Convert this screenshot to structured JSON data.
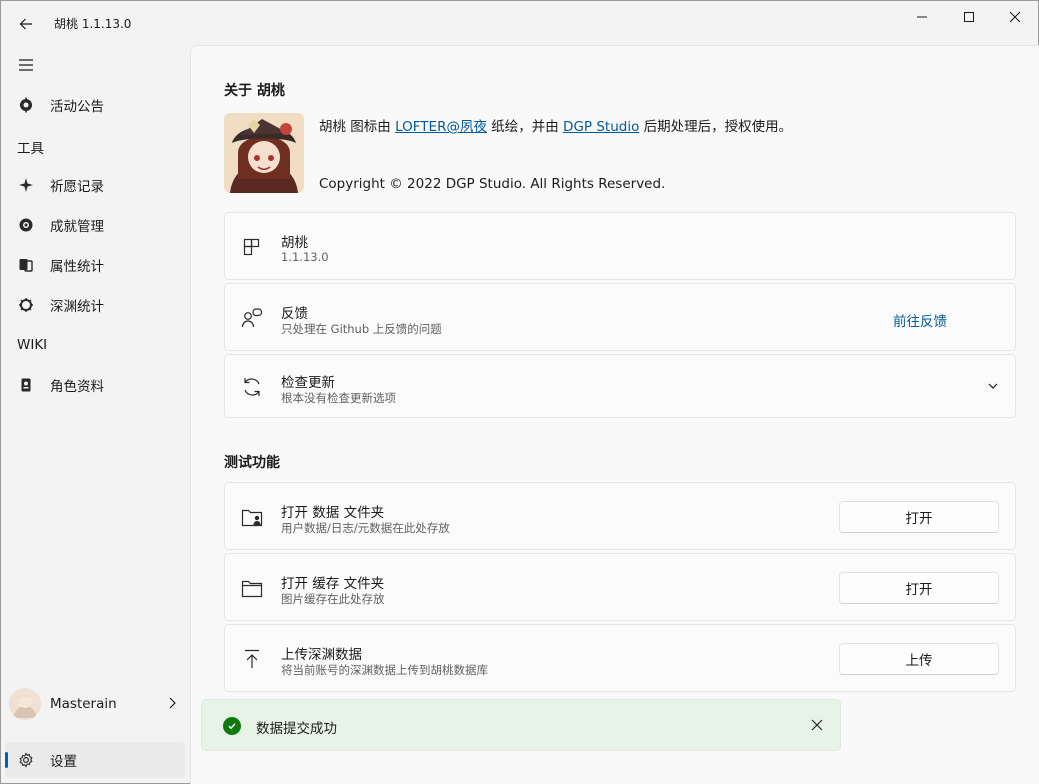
{
  "titlebar": {
    "title": "胡桃 1.1.13.0"
  },
  "sidebar": {
    "items": [
      {
        "label": "活动公告"
      },
      {
        "label": "祈愿记录"
      },
      {
        "label": "成就管理"
      },
      {
        "label": "属性统计"
      },
      {
        "label": "深渊统计"
      },
      {
        "label": "角色资料"
      }
    ],
    "headers": {
      "tools": "工具",
      "wiki": "WIKI"
    },
    "user": {
      "name": "Masterain"
    },
    "settings": {
      "label": "设置"
    }
  },
  "about": {
    "title": "关于 胡桃",
    "desc_prefix": "胡桃 图标由 ",
    "desc_link1": "LOFTER@夙夜",
    "desc_mid": " 纸绘，并由 ",
    "desc_link2": "DGP Studio",
    "desc_suffix": " 后期处理后，授权使用。",
    "copyright": "Copyright © 2022 DGP Studio. All Rights Reserved."
  },
  "cards": {
    "version": {
      "title": "胡桃",
      "sub": "1.1.13.0"
    },
    "feedback": {
      "title": "反馈",
      "sub": "只处理在 Github 上反馈的问题",
      "action": "前往反馈"
    },
    "update": {
      "title": "检查更新",
      "sub": "根本没有检查更新选项"
    }
  },
  "test": {
    "title": "测试功能",
    "data_folder": {
      "title": "打开 数据 文件夹",
      "sub": "用户数据/日志/元数据在此处存放",
      "button": "打开"
    },
    "cache_folder": {
      "title": "打开 缓存 文件夹",
      "sub": "图片缓存在此处存放",
      "button": "打开"
    },
    "upload": {
      "title": "上传深渊数据",
      "sub": "将当前账号的深渊数据上传到胡桃数据库",
      "button": "上传"
    }
  },
  "toast": {
    "message": "数据提交成功"
  },
  "colors": {
    "accent": "#005fb8",
    "link": "#005a9e",
    "success": "#0f7b0f"
  }
}
